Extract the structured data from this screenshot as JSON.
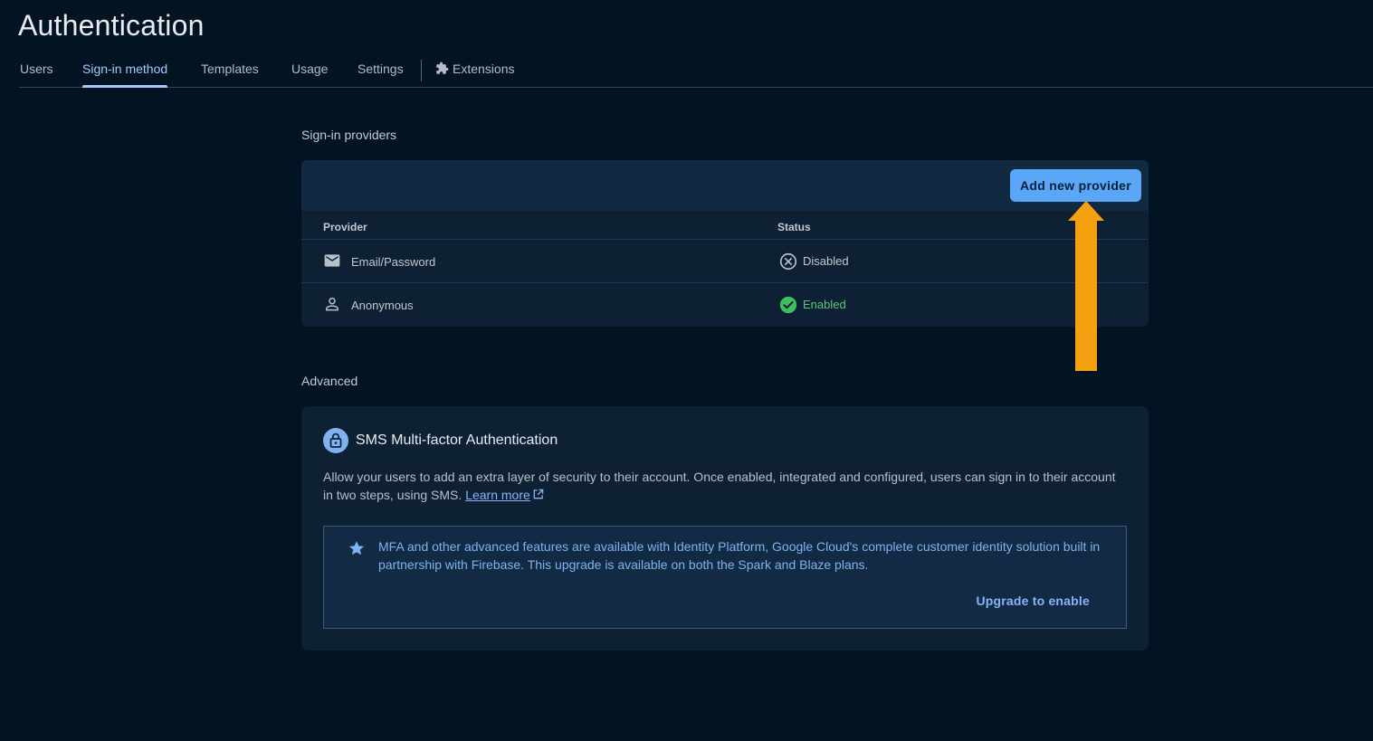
{
  "page": {
    "title": "Authentication"
  },
  "tabs": [
    {
      "label": "Users"
    },
    {
      "label": "Sign-in method",
      "active": true
    },
    {
      "label": "Templates"
    },
    {
      "label": "Usage"
    },
    {
      "label": "Settings"
    },
    {
      "label": "Extensions",
      "icon": "puzzle-icon"
    }
  ],
  "providers_section": {
    "label": "Sign-in providers",
    "add_button": "Add new provider",
    "columns": {
      "provider": "Provider",
      "status": "Status"
    },
    "rows": [
      {
        "provider": "Email/Password",
        "icon": "mail-icon",
        "status": "Disabled",
        "status_icon": "x-circle-icon"
      },
      {
        "provider": "Anonymous",
        "icon": "person-icon",
        "status": "Enabled",
        "status_icon": "check-circle-icon"
      }
    ]
  },
  "advanced_section": {
    "label": "Advanced",
    "mfa": {
      "title": "SMS Multi-factor Authentication",
      "description": "Allow your users to add an extra layer of security to their account. Once enabled, integrated and configured, users can sign in to their account in two steps, using SMS.",
      "learn_more": "Learn more",
      "info_text": "MFA and other advanced features are available with Identity Platform, Google Cloud's complete customer identity solution built in partnership with Firebase. This upgrade is available on both the Spark and Blaze plans.",
      "upgrade_link": "Upgrade to enable"
    }
  },
  "colors": {
    "background": "#021322",
    "accent": "#a8c7fa",
    "button": "#5aa6f7",
    "enabled": "#5ec77a",
    "arrow": "#f5a00e"
  }
}
